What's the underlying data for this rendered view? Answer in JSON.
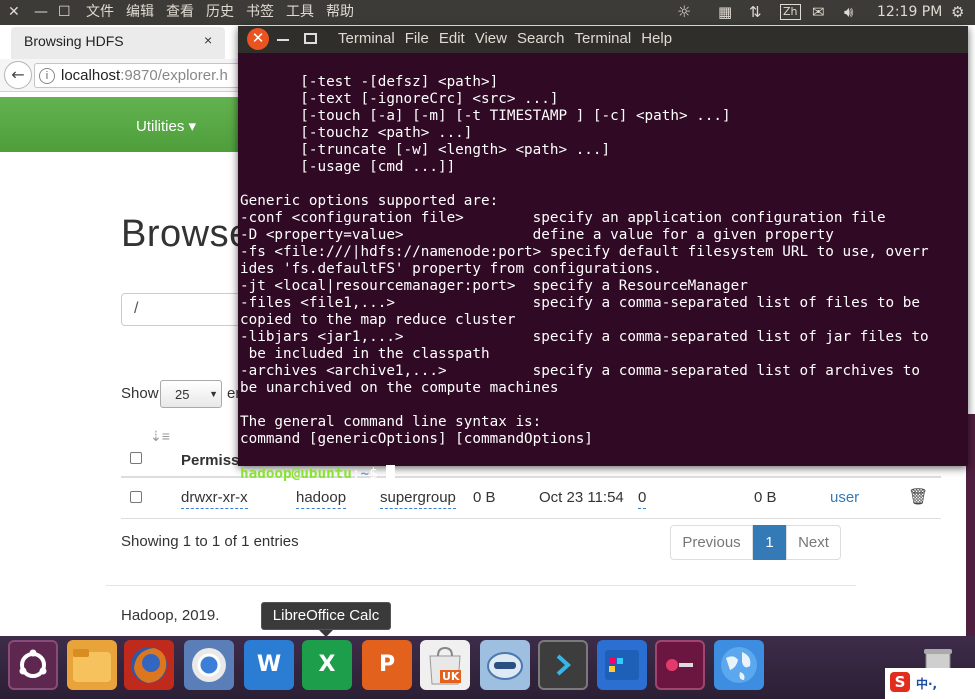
{
  "top_panel": {
    "close": "✕",
    "minimize": "—",
    "maximize": "☐",
    "menus": [
      "文件",
      "编辑",
      "查看",
      "历史",
      "书签",
      "工具",
      "帮助"
    ],
    "ime_label": "Zh",
    "time": "12:19 PM"
  },
  "browser": {
    "tab_title": "Browsing HDFS",
    "tab_close": "×",
    "url_host": "localhost",
    "url_rest": ":9870/explorer.h",
    "nav_utilities": "Utilities ▾",
    "heading": "Browse",
    "path_value": "/",
    "show_label": "Show",
    "entries_value": "25",
    "entries_suffix": "er",
    "header_permission": "Permissi",
    "row": {
      "permission": "drwxr-xr-x",
      "owner": "hadoop",
      "group": "supergroup",
      "size": "0 B",
      "last_modified": "Oct 23 11:54",
      "replication": "0",
      "block_size": "0 B",
      "name": "user"
    },
    "showing_text": "Showing 1 to 1 of 1 entries",
    "pager_previous": "Previous",
    "pager_page": "1",
    "pager_next": "Next",
    "footer": "Hadoop, 2019."
  },
  "terminal": {
    "menu": [
      "Terminal",
      "File",
      "Edit",
      "View",
      "Search",
      "Terminal",
      "Help"
    ],
    "lines": [
      "       [-test -[defsz] <path>]",
      "       [-text [-ignoreCrc] <src> ...]",
      "       [-touch [-a] [-m] [-t TIMESTAMP ] [-c] <path> ...]",
      "       [-touchz <path> ...]",
      "       [-truncate [-w] <length> <path> ...]",
      "       [-usage [cmd ...]]",
      "",
      "Generic options supported are:",
      "-conf <configuration file>        specify an application configuration file",
      "-D <property=value>               define a value for a given property",
      "-fs <file:///|hdfs://namenode:port> specify default filesystem URL to use, overr",
      "ides 'fs.defaultFS' property from configurations.",
      "-jt <local|resourcemanager:port>  specify a ResourceManager",
      "-files <file1,...>                specify a comma-separated list of files to be",
      "copied to the map reduce cluster",
      "-libjars <jar1,...>               specify a comma-separated list of jar files to",
      " be included in the classpath",
      "-archives <archive1,...>          specify a comma-separated list of archives to",
      "be unarchived on the compute machines",
      "",
      "The general command line syntax is:",
      "command [genericOptions] [commandOptions]",
      ""
    ],
    "prompt_user": "hadoop@ubuntu",
    "prompt_sep": ":",
    "prompt_path": "~",
    "prompt_char": "$ "
  },
  "tooltip": "LibreOffice Calc",
  "dock": {
    "items": [
      {
        "name": "ubuntu-dash-icon",
        "color": "#5e2750"
      },
      {
        "name": "files-icon",
        "color": "#e9a33b"
      },
      {
        "name": "firefox-icon",
        "color": "#e66000"
      },
      {
        "name": "chromium-icon",
        "color": "#3c7fd8"
      },
      {
        "name": "wps-writer-icon",
        "color": "#2b7cd3"
      },
      {
        "name": "wps-spreadsheet-icon",
        "color": "#1d9e4a"
      },
      {
        "name": "wps-presentation-icon",
        "color": "#e2611d"
      },
      {
        "name": "software-center-icon",
        "color": "#f0f0f0"
      },
      {
        "name": "updater-icon",
        "color": "#7aa7d8"
      },
      {
        "name": "terminal-icon",
        "color": "#3d3d3d"
      },
      {
        "name": "window-manager-icon",
        "color": "#2a6fd1"
      },
      {
        "name": "recorder-icon",
        "color": "#6b1640"
      },
      {
        "name": "maps-icon",
        "color": "#3d8ee0"
      }
    ],
    "uk_badge": "UK",
    "ime_s": "S",
    "ime_zh": "中·,"
  }
}
